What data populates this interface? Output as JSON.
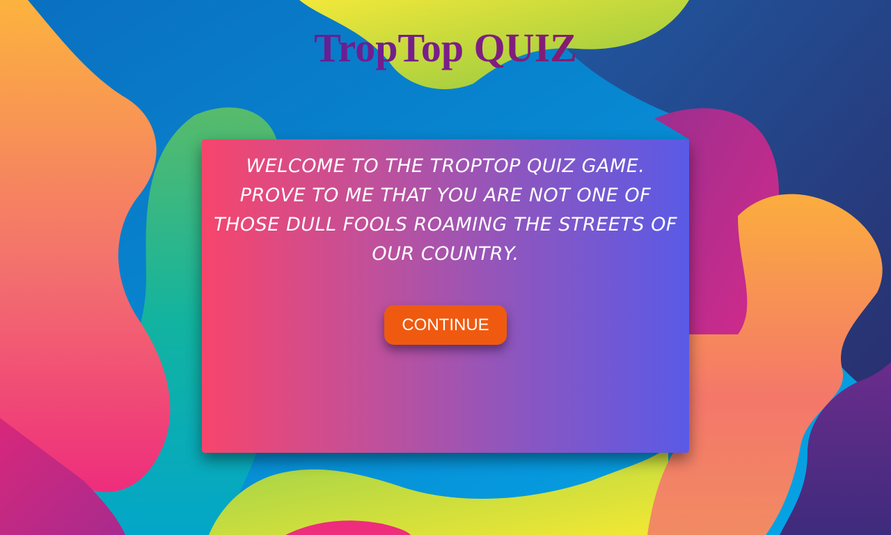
{
  "header": {
    "title": "TropTop QUIZ"
  },
  "welcome_card": {
    "message": "Welcome to the TropTop quiz game. Prove to me that you are not one of those dull fools roaming the streets of our country.",
    "continue_label": "CONTINUE"
  },
  "colors": {
    "card_gradient_start": "#f7456c",
    "card_gradient_end": "#5a5ae6",
    "button": "#ef5a10",
    "title_gradient_start": "#3b1ea8",
    "title_gradient_end": "#a01830"
  }
}
